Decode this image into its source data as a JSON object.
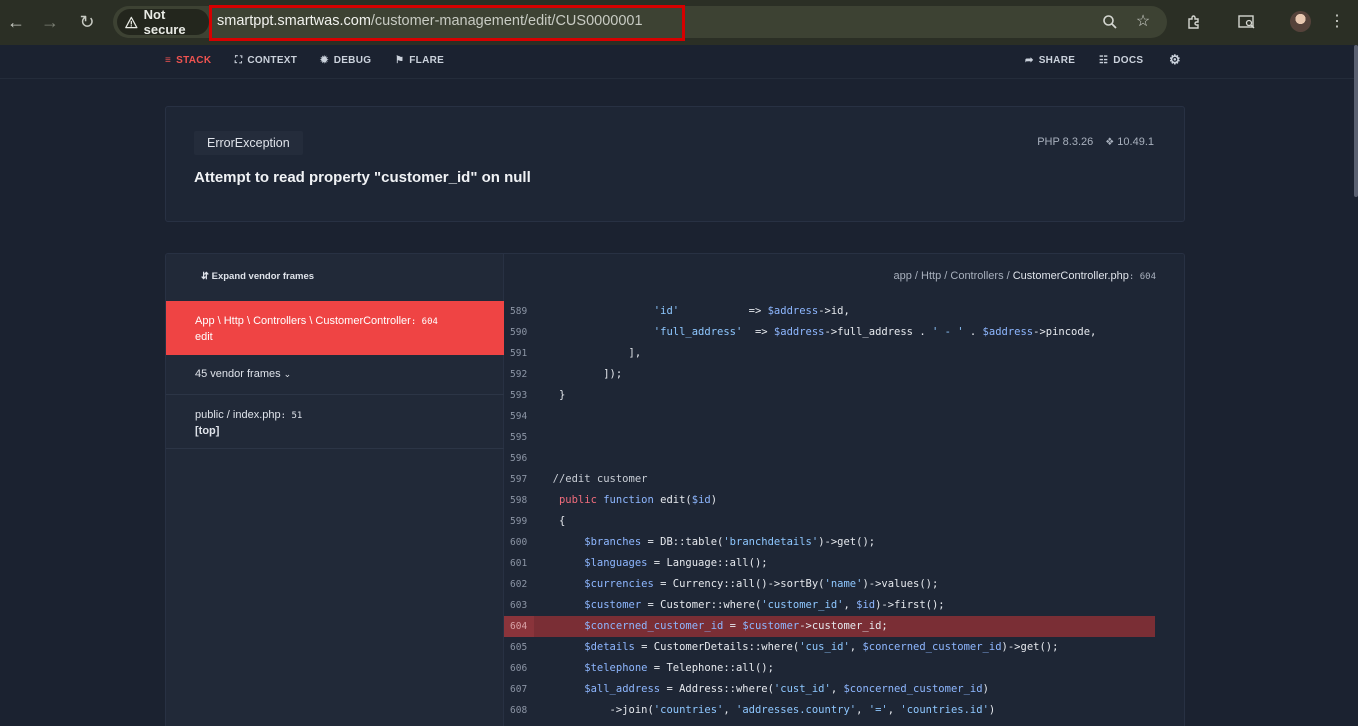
{
  "browser": {
    "security_label": "Not secure",
    "url_host": "smartppt.smartwas.com",
    "url_path": "/customer-management/edit/CUS0000001"
  },
  "toolbar": {
    "stack": "STACK",
    "context": "CONTEXT",
    "debug": "DEBUG",
    "flare": "FLARE",
    "share": "SHARE",
    "docs": "DOCS"
  },
  "error": {
    "exception": "ErrorException",
    "message": "Attempt to read property \"customer_id\" on null",
    "php_version": "PHP 8.3.26",
    "laravel_version": "10.49.1"
  },
  "frames": {
    "expand_vendor": "Expand vendor frames",
    "active": {
      "path": "App \\ Http \\ Controllers \\ CustomerController",
      "line": ": 604",
      "method": "edit"
    },
    "vendor": "45 vendor frames",
    "public": {
      "path": "public / index.php",
      "line": ": 51",
      "method": "[top]"
    }
  },
  "file": {
    "dir": "app / Http / Controllers / ",
    "name": "CustomerController.php",
    "line": ": 604"
  },
  "code_lines": [
    {
      "n": "589"
    },
    {
      "n": "590"
    },
    {
      "n": "591"
    },
    {
      "n": "592"
    },
    {
      "n": "593"
    },
    {
      "n": "594"
    },
    {
      "n": "595"
    },
    {
      "n": "596"
    },
    {
      "n": "597"
    },
    {
      "n": "598"
    },
    {
      "n": "599"
    },
    {
      "n": "600"
    },
    {
      "n": "601"
    },
    {
      "n": "602"
    },
    {
      "n": "603"
    },
    {
      "n": "604"
    },
    {
      "n": "605"
    },
    {
      "n": "606"
    },
    {
      "n": "607"
    },
    {
      "n": "608"
    }
  ],
  "colors": {
    "accent_red": "#ef4444",
    "highlight_line": "#7a2e35",
    "variable_blue": "#8eb7ff",
    "keyword_red": "#f06c7c"
  }
}
